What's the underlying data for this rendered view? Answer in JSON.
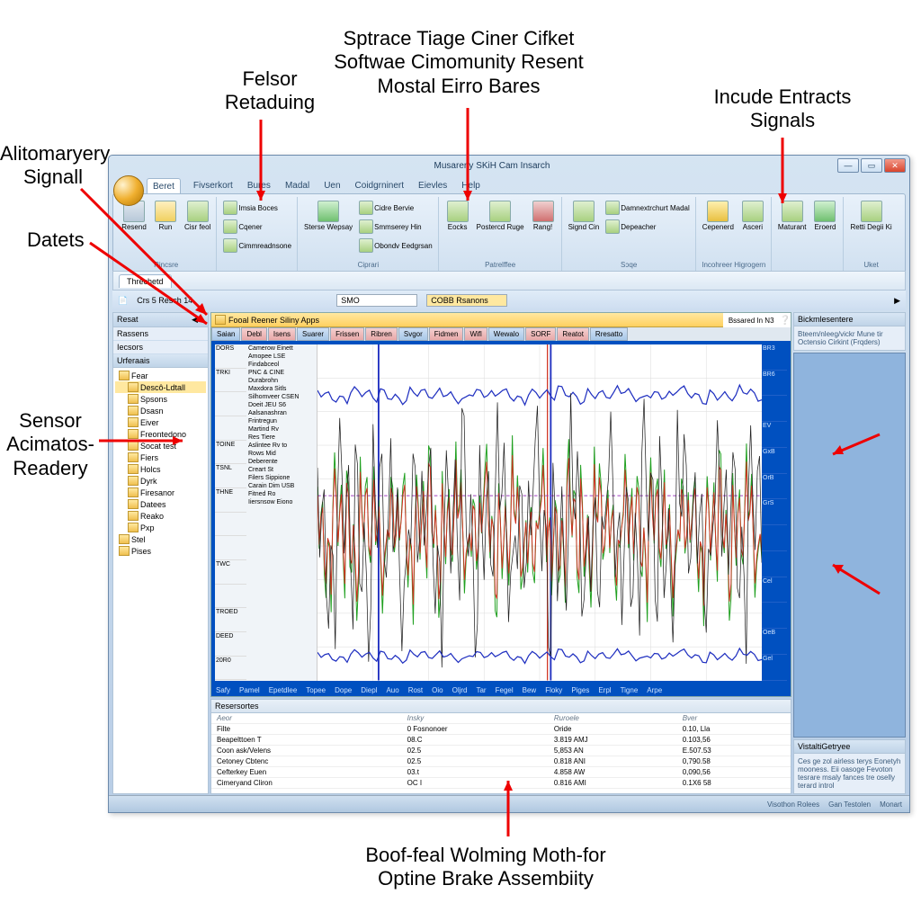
{
  "annotations": {
    "a1": "Alitomaryery\nSignall",
    "a2": "Datets",
    "a3": "Sensor\nAcimatos-\nReadery",
    "a4": "Felsor\nRetaduing",
    "a5": "Sptrace Tiage Ciner Cifket\nSoftwae Cimomunity Resent\nMostal Eirro Bares",
    "a6": "Incude Entracts\nSignals",
    "a7": "Boof-feal Wolming Moth-for\nOptine Brake Assembiity"
  },
  "titlebar": {
    "title": "Musareriy SKiH Cam Insarch"
  },
  "menu": [
    "Beret",
    "Fivserkort",
    "Bures",
    "Madal",
    "Uen",
    "Coidgrninert",
    "Eievles",
    "Help"
  ],
  "ribbon": {
    "g1": {
      "lbl": "Rincsre",
      "b1": "Resend",
      "b2": "Run",
      "b3": "Cisr feol"
    },
    "g2": {
      "lbl": "",
      "s1": "Imsia Boces",
      "s2": "Cqener",
      "s3": "Cimmreadnsone"
    },
    "g3": {
      "lbl": "Ciprari",
      "b1": "Sterse Wepsay",
      "s1": "Cidre Bervie",
      "s2": "Smmserey Hin",
      "s3": "Obondv Eedgrsan"
    },
    "g4": {
      "lbl": "Patrelffee",
      "b1": "Eocks",
      "b2": "Postercd Ruge",
      "b3": "Rang!"
    },
    "g5": {
      "lbl": "Sɔqe",
      "b1": "Signd Cin",
      "s1": "Damnextrchurt Madal",
      "s2": "Depeacher"
    },
    "g6": {
      "lbl": "Incohreer Higrogern",
      "b1": "Cepenerd",
      "b2": "Asceri"
    },
    "g7": {
      "lbl": "",
      "b1": "Maturant",
      "b2": "Eroerd"
    },
    "g8": {
      "lbl": "Uket",
      "b1": "Retti Degii Ki"
    }
  },
  "subtabs": {
    "t1": "Threchetd"
  },
  "addr": {
    "crumb": "Crs 5 Resch 14",
    "combo1": "SMO",
    "combo2": "COBB Rsanons"
  },
  "sidebar": {
    "h1": "Resat",
    "h2": "Rassens",
    "h3": "Iecsors",
    "h4": "Urferaais",
    "tree": [
      "Fear",
      "Descô-Ldtall",
      "Spsons",
      "Dsasn",
      "Eiver",
      "Freontedono",
      "Socat test",
      "Fiers",
      "Holcs",
      "Dyrk",
      "Firesanor",
      "Datees",
      "Reako",
      "Pxp",
      "Stel",
      "Pises"
    ]
  },
  "viewer": {
    "title": "Fooal Reener Siliny Apps",
    "toptabs": [
      "Saian",
      "Debl",
      "Isens",
      "Suarer",
      "Frissen",
      "Ribren",
      "Svgor",
      "Fidmen",
      "Wifl",
      "Wewalo",
      "SORF",
      "Reatot",
      "Rresatto"
    ],
    "ylabs": [
      "DORS",
      "TRKI",
      "",
      "",
      "TOINE",
      "TSNL",
      "THNE",
      "",
      "",
      "TWC",
      "",
      "TROED",
      "DEED",
      "20R0"
    ],
    "legend": [
      "Camerow Einett",
      "Amopee LSE",
      "Findabceol",
      "PNC & CINE",
      "Durabrohn",
      "Maxdora Sitls",
      "Silhomveer CSEN",
      "Doeit JEU S6",
      "Aalsanashran",
      "Frintregun",
      "Martind Rv",
      "Res Tiere",
      "Aslintee Rv to",
      "Rows Mid",
      "Deberente",
      "Creart St",
      "Filers Sippione",
      "Carain Dim USB",
      "Fitned Ro",
      "Iiersnsow Eiono"
    ],
    "rscale": [
      "BR3",
      "BR6",
      "",
      "EV",
      "GxB",
      "OrB",
      "GrS",
      "",
      "",
      "Cel",
      "",
      "OeB",
      "Gel"
    ],
    "btabs": [
      "Safy",
      "Pamel",
      "Epetdlee",
      "Topee",
      "Dope",
      "Diepl",
      "Auo",
      "Rost",
      "Oio",
      "Oljrd",
      "Tar",
      "Fegel",
      "Bew",
      "Floky",
      "Piges",
      "Erpl",
      "Tigne",
      "Arpe"
    ],
    "searchlabel": "Bssared In N3"
  },
  "props": {
    "title": "Resersortes",
    "h": [
      "Aeor",
      "Insky",
      "Ruroele",
      "Bver"
    ],
    "r": [
      [
        "Filte",
        "0 Fosnonoer",
        "Oride",
        "0.10, Lla"
      ],
      [
        "Beapelttoen T",
        "08.C",
        "3.819 AMJ",
        "0.103,56"
      ],
      [
        "Coon ask/Velens",
        "02.5",
        "5,853 AN",
        "E.507.53"
      ],
      [
        "Cetoney Cbtenc",
        "02.5",
        "0.818 ANI",
        "0,790.58"
      ],
      [
        "Cefterkey Euen",
        "03.t",
        "4.858 AW",
        "0,090,56"
      ],
      [
        "Cimeryand Cliron",
        "OC I",
        "0.816 AMI",
        "0.1X6 58"
      ]
    ]
  },
  "rside": {
    "h1": "Bickmlesentere",
    "t1": "Bteem/nleeg/vickr Mune tir Octensio Cirkint (Frqders)",
    "h2": "VistaltiGetryee",
    "t2": "Ces ge zol airless terys Eonetyh mooness. Eii oasoge Fevoton tesrare msaly fances tre oselly terard introl"
  },
  "status": {
    "s1": "Visothon Rolees",
    "s2": "Gan Testolen",
    "s3": "Monart"
  },
  "chart_data": {
    "type": "line",
    "title": "Fooal Reener Siliny Apps",
    "x_range": [
      0,
      100
    ],
    "series": [
      {
        "name": "trace-top",
        "color": "#2030c0",
        "values_desc": "near-flat line at ~85% height with small jitter"
      },
      {
        "name": "trace-mid-dashed",
        "color": "#a040c0",
        "style": "dashed",
        "values_desc": "flat line at ~55% height"
      },
      {
        "name": "trace-noise-green",
        "color": "#20a020",
        "values_desc": "dense high-frequency noise centered at 45%, amplitude ±25%"
      },
      {
        "name": "trace-noise-red",
        "color": "#d03020",
        "values_desc": "dense high-frequency noise centered at 45%, amplitude ±20%, overlapping green"
      },
      {
        "name": "trace-noise-black",
        "color": "#202020",
        "values_desc": "sparse tall spikes over the noise band, amplitude ±35%"
      },
      {
        "name": "trace-bottom",
        "color": "#2030c0",
        "values_desc": "near-flat line at ~8% height"
      }
    ],
    "vlines": [
      {
        "x": 14,
        "color": "#2030c0"
      },
      {
        "x": 52,
        "color": "#d03020"
      },
      {
        "x": 52.5,
        "color": "#2030c0"
      }
    ]
  }
}
